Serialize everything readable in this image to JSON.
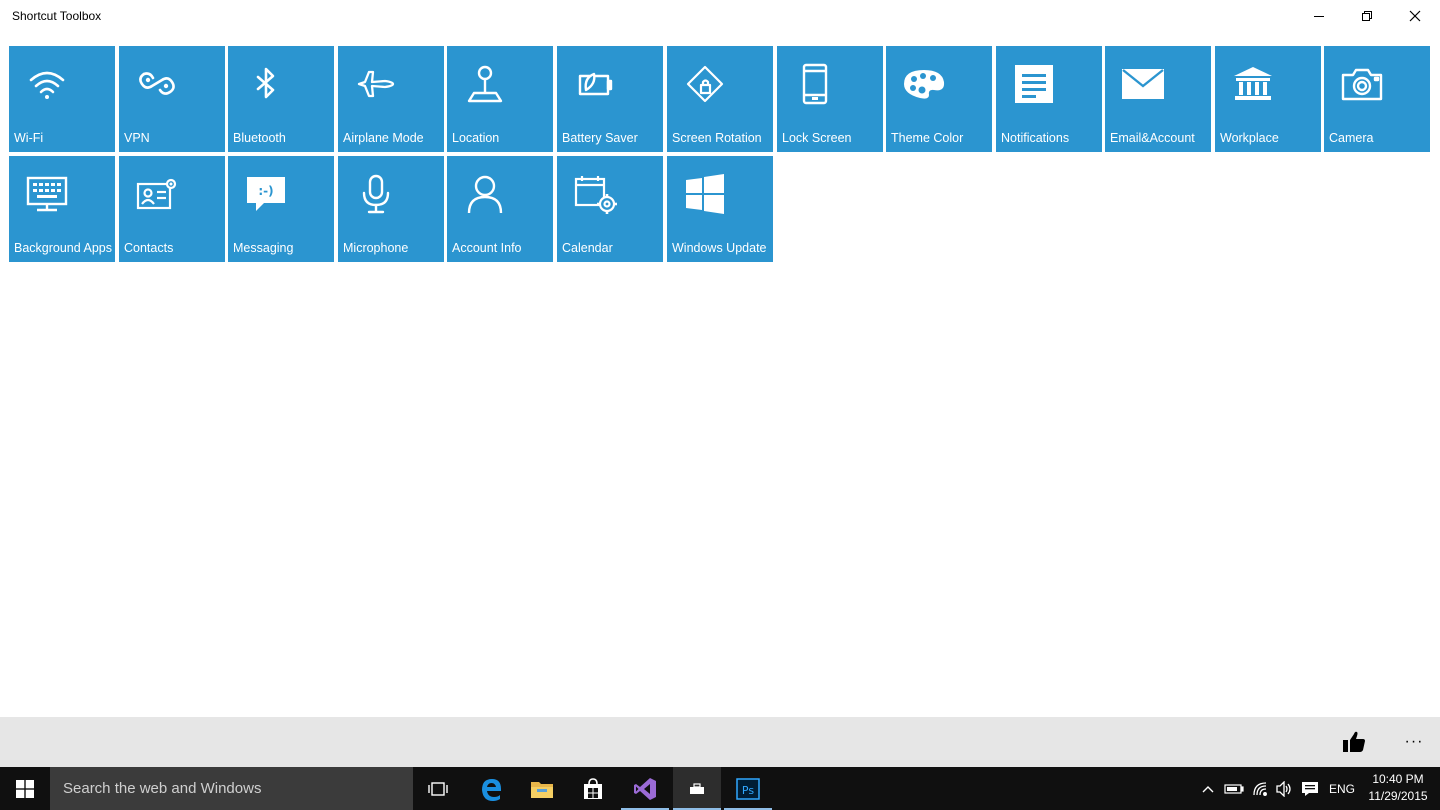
{
  "window": {
    "title": "Shortcut Toolbox"
  },
  "tiles": [
    {
      "label": "Wi-Fi",
      "icon": "wifi-icon"
    },
    {
      "label": "VPN",
      "icon": "vpn-icon"
    },
    {
      "label": "Bluetooth",
      "icon": "bluetooth-icon"
    },
    {
      "label": "Airplane Mode",
      "icon": "airplane-icon"
    },
    {
      "label": "Location",
      "icon": "location-icon"
    },
    {
      "label": "Battery Saver",
      "icon": "battery-saver-icon"
    },
    {
      "label": "Screen Rotation",
      "icon": "screen-rotation-icon"
    },
    {
      "label": "Lock Screen",
      "icon": "lock-screen-icon"
    },
    {
      "label": "Theme Color",
      "icon": "palette-icon"
    },
    {
      "label": "Notifications",
      "icon": "notifications-icon"
    },
    {
      "label": "Email&Account",
      "icon": "email-icon"
    },
    {
      "label": "Workplace",
      "icon": "workplace-icon"
    },
    {
      "label": "Camera",
      "icon": "camera-icon"
    },
    {
      "label": "Background Apps",
      "icon": "background-apps-icon"
    },
    {
      "label": "Contacts",
      "icon": "contacts-icon"
    },
    {
      "label": "Messaging",
      "icon": "messaging-icon"
    },
    {
      "label": "Microphone",
      "icon": "microphone-icon"
    },
    {
      "label": "Account Info",
      "icon": "account-icon"
    },
    {
      "label": "Calendar",
      "icon": "calendar-icon"
    },
    {
      "label": "Windows Update",
      "icon": "windows-update-icon"
    }
  ],
  "appbar": {
    "like_icon": "thumbs-up-icon",
    "more_label": "···"
  },
  "taskbar": {
    "search_placeholder": "Search the web and Windows",
    "apps": [
      "task-view-icon",
      "edge-icon",
      "file-explorer-icon",
      "store-icon",
      "visual-studio-icon",
      "shortcut-toolbox-icon",
      "photoshop-icon"
    ],
    "photoshop_label": "Ps",
    "language": "ENG",
    "time": "10:40 PM",
    "date": "11/29/2015"
  },
  "colors": {
    "tile": "#2b95d0",
    "taskbar": "#101010",
    "search": "#3b3b3b",
    "appbar": "#e6e6e6"
  }
}
